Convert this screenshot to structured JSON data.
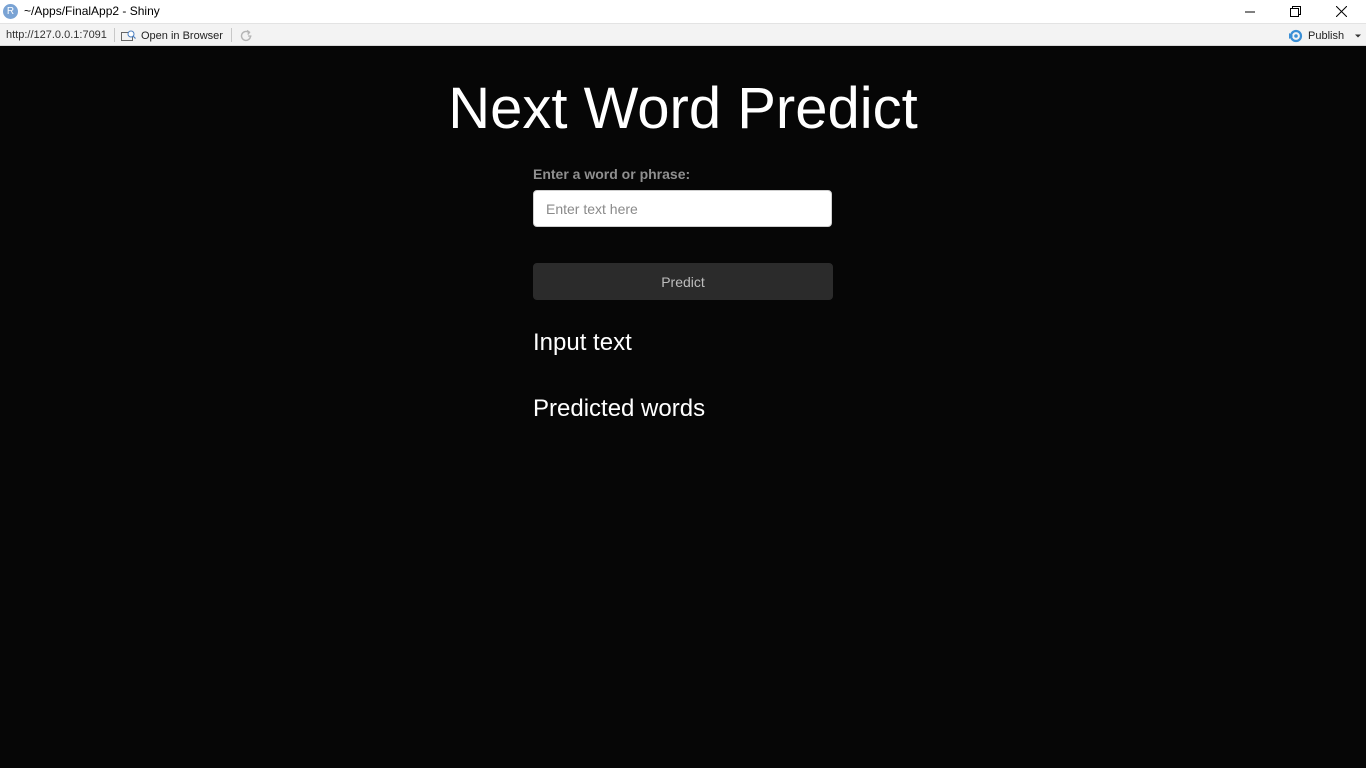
{
  "window": {
    "app_icon": "R",
    "title": "~/Apps/FinalApp2 - Shiny",
    "controls": [
      "minimize-icon",
      "restore-icon",
      "close-icon"
    ]
  },
  "toolbar": {
    "url": "http://127.0.0.1:7091",
    "open_in_browser": "Open in Browser",
    "publish": "Publish"
  },
  "app": {
    "title": "Next Word Predict",
    "input_label": "Enter a word or phrase:",
    "input_placeholder": "Enter text here",
    "input_value": "",
    "predict_button": "Predict",
    "input_text_heading": "Input text",
    "predicted_words_heading": "Predicted words"
  },
  "colors": {
    "background": "#060606",
    "text": "#ffffff",
    "label": "#8f8f8f",
    "button_bg": "#2b2b2b",
    "publish_accent": "#3a8fd6"
  }
}
